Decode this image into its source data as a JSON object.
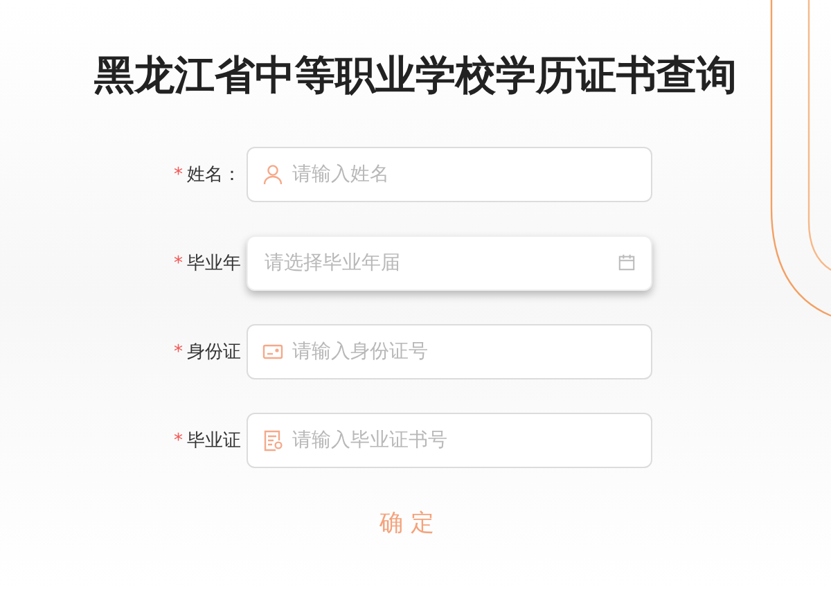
{
  "title": "黑龙江省中等职业学校学历证书查询",
  "fields": [
    {
      "label": "姓名：",
      "required_mark": "*",
      "kind": "user",
      "placeholder": "请输入姓名",
      "focused": false
    },
    {
      "label": "毕业年",
      "required_mark": "*",
      "kind": "date",
      "placeholder": "请选择毕业年届",
      "focused": true
    },
    {
      "label": "身份证",
      "required_mark": "*",
      "kind": "idcard",
      "placeholder": "请输入身份证号",
      "focused": false
    },
    {
      "label": "毕业证",
      "required_mark": "*",
      "kind": "certificate",
      "placeholder": "请输入毕业证书号",
      "focused": false
    }
  ],
  "submit": "确 定"
}
